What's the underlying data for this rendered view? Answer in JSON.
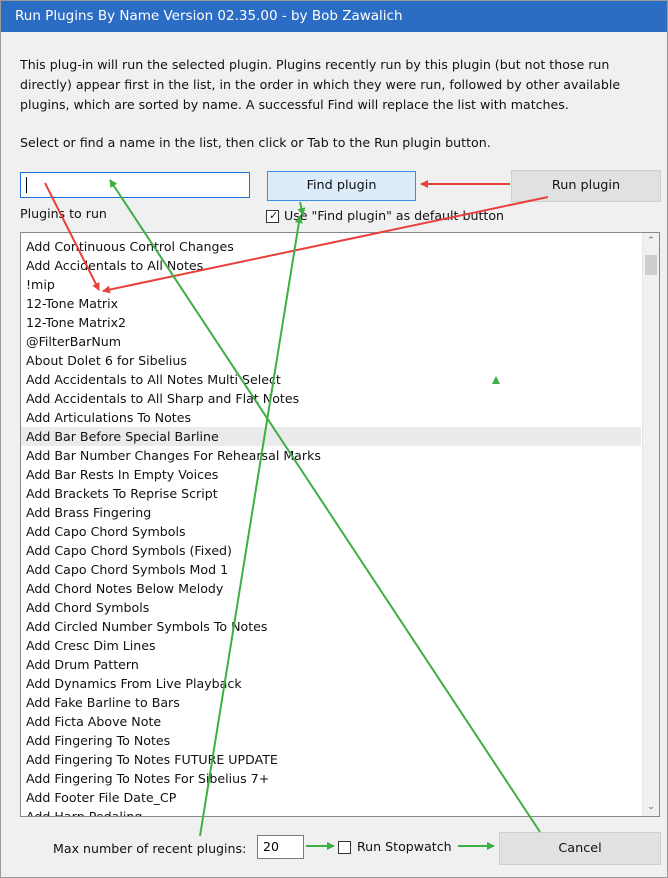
{
  "window": {
    "title": "Run Plugins By Name  Version 02.35.00 - by Bob Zawalich"
  },
  "description": "This plug-in will run the selected plugin. Plugins recently run by this plugin (but not those run directly) appear first in the list, in the order in which they were run, followed by other available plugins, which are sorted by name. A successful Find will replace the list with matches.",
  "instruction": "Select or find a name in the list, then click or Tab to the Run plugin button.",
  "search": {
    "value": "",
    "placeholder": ""
  },
  "buttons": {
    "find": "Find plugin",
    "run": "Run plugin",
    "cancel": "Cancel"
  },
  "plugins_label": "Plugins to run",
  "default_button_checkbox": {
    "label": "Use \"Find plugin\" as default button",
    "checked": true
  },
  "plugin_list": {
    "selected_index": 10,
    "items": [
      "Add Continuous Control Changes",
      "Add Accidentals to All Notes",
      "!mip",
      "12-Tone Matrix",
      "12-Tone Matrix2",
      "@FilterBarNum",
      "About Dolet 6 for Sibelius",
      "Add Accidentals to All Notes Multi Select",
      "Add Accidentals to All Sharp and Flat Notes",
      "Add Articulations To Notes",
      "Add Bar Before Special Barline",
      "Add Bar Number Changes For Rehearsal Marks",
      "Add Bar Rests In Empty Voices",
      "Add Brackets To Reprise Script",
      "Add Brass Fingering",
      "Add Capo Chord Symbols",
      "Add Capo Chord Symbols (Fixed)",
      "Add Capo Chord Symbols Mod 1",
      "Add Chord Notes Below Melody",
      "Add Chord Symbols",
      "Add Circled Number Symbols To Notes",
      "Add Cresc Dim Lines",
      "Add Drum Pattern",
      "Add Dynamics From Live Playback",
      "Add Fake Barline to Bars",
      "Add Ficta Above Note",
      "Add Fingering To Notes",
      "Add Fingering To Notes FUTURE UPDATE",
      "Add Fingering To Notes For Sibelius 7+",
      "Add Footer File Date_CP",
      "Add Harp Pedaling"
    ]
  },
  "max_recent": {
    "label": "Max number of recent plugins:",
    "value": "20"
  },
  "stopwatch_checkbox": {
    "label": "Run Stopwatch",
    "checked": false
  },
  "icons": {
    "scroll_up": "chevron-up-icon",
    "scroll_down": "chevron-down-icon",
    "checkmark": "checkmark-icon"
  },
  "colors": {
    "titlebar": "#2b6cc4",
    "annotation_red": "#e8413c",
    "annotation_green": "#3cb043",
    "find_button_bg": "#dcecfb",
    "selected_row": "#ebebeb"
  }
}
